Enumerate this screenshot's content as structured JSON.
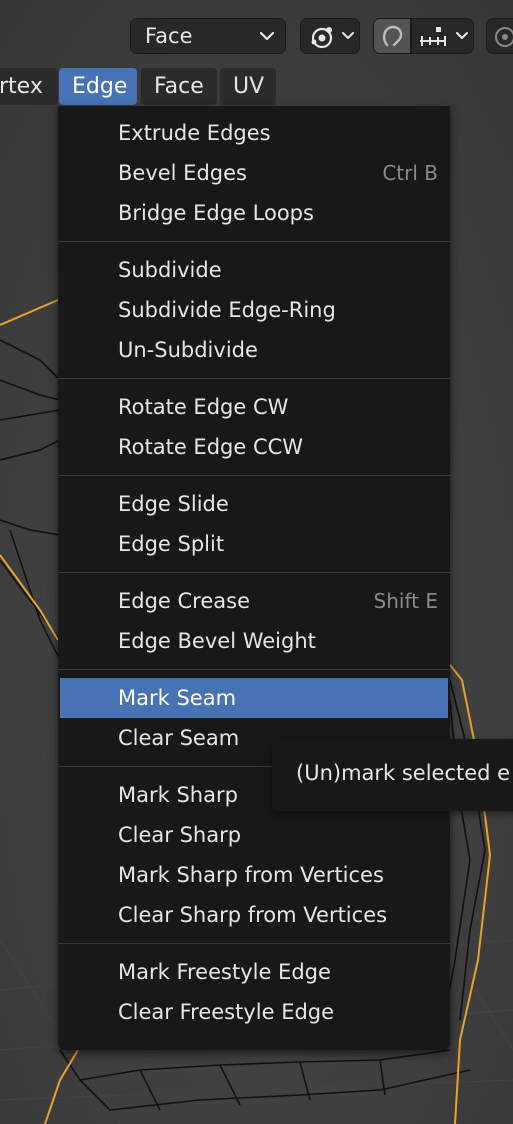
{
  "header": {
    "select_mode_label": "Face"
  },
  "menubar": {
    "items": [
      "rtex",
      "Edge",
      "Face",
      "UV"
    ],
    "selected": "Edge"
  },
  "menu": {
    "groups": [
      [
        {
          "label": "Extrude Edges",
          "shortcut": ""
        },
        {
          "label": "Bevel Edges",
          "shortcut": "Ctrl B"
        },
        {
          "label": "Bridge Edge Loops",
          "shortcut": ""
        }
      ],
      [
        {
          "label": "Subdivide",
          "shortcut": ""
        },
        {
          "label": "Subdivide Edge-Ring",
          "shortcut": ""
        },
        {
          "label": "Un-Subdivide",
          "shortcut": ""
        }
      ],
      [
        {
          "label": "Rotate Edge CW",
          "shortcut": ""
        },
        {
          "label": "Rotate Edge CCW",
          "shortcut": ""
        }
      ],
      [
        {
          "label": "Edge Slide",
          "shortcut": ""
        },
        {
          "label": "Edge Split",
          "shortcut": ""
        }
      ],
      [
        {
          "label": "Edge Crease",
          "shortcut": "Shift E"
        },
        {
          "label": "Edge Bevel Weight",
          "shortcut": ""
        }
      ],
      [
        {
          "label": "Mark Seam",
          "shortcut": "",
          "highlighted": true
        },
        {
          "label": "Clear Seam",
          "shortcut": ""
        }
      ],
      [
        {
          "label": "Mark Sharp",
          "shortcut": ""
        },
        {
          "label": "Clear Sharp",
          "shortcut": ""
        },
        {
          "label": "Mark Sharp from Vertices",
          "shortcut": ""
        },
        {
          "label": "Clear Sharp from Vertices",
          "shortcut": ""
        }
      ],
      [
        {
          "label": "Mark Freestyle Edge",
          "shortcut": ""
        },
        {
          "label": "Clear Freestyle Edge",
          "shortcut": ""
        }
      ]
    ]
  },
  "tooltip": {
    "text": "(Un)mark selected e"
  },
  "colors": {
    "accent": "#4772b3",
    "menu_bg": "#181818",
    "mesh_outline": "#e8a22a"
  },
  "icons": [
    "chevron-down-icon",
    "proportional-pivot-icon",
    "snap-magnet-icon",
    "snap-increment-icon",
    "proportional-editing-icon"
  ]
}
